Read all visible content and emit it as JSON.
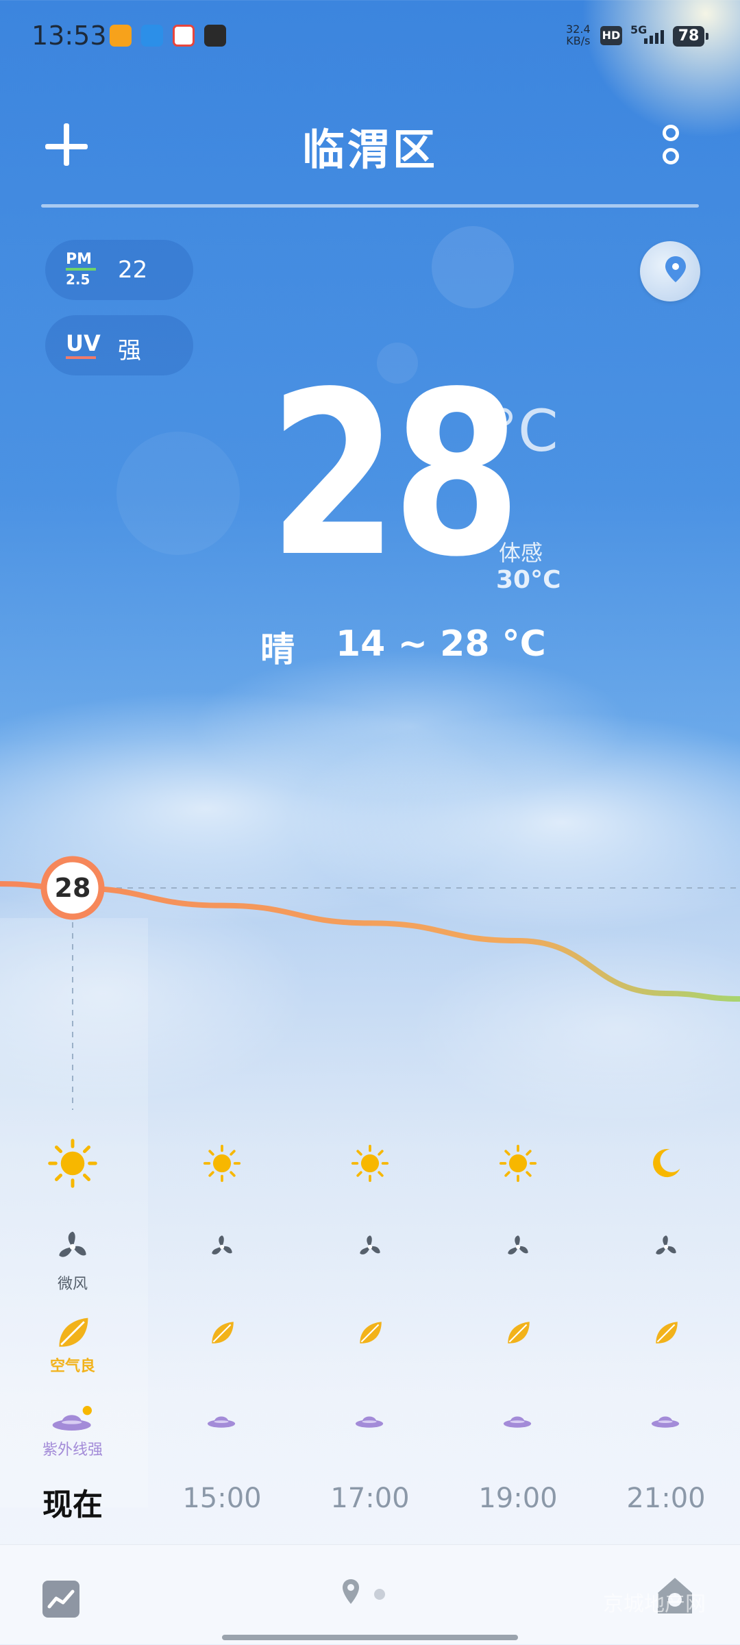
{
  "status_bar": {
    "time": "13:53",
    "app_icons": [
      {
        "name": "weibo-icon",
        "color": "#f7a21b"
      },
      {
        "name": "traffic-app-icon",
        "color": "#2c8fe8"
      },
      {
        "name": "map-app-icon",
        "color": "#e8453c"
      },
      {
        "name": "soul-app-icon",
        "color": "#2a2a2a"
      }
    ],
    "net_rate": "32.4",
    "net_unit": "KB/s",
    "hd": "HD",
    "signal": "5G",
    "battery": "78"
  },
  "header": {
    "city": "临渭区"
  },
  "air": {
    "pm_top": "PM",
    "pm_bottom": "2.5",
    "pm_value": "22",
    "uv_label": "UV",
    "uv_value": "强"
  },
  "current": {
    "temp": "28",
    "unit": "°C",
    "feels_label": "体感",
    "feels_value": "30°C",
    "condition": "晴",
    "range": "14 ~ 28 °C"
  },
  "chart_data": {
    "type": "line",
    "x": [
      "现在",
      "15:00",
      "17:00",
      "19:00",
      "21:00"
    ],
    "series": [
      {
        "values": [
          28,
          27,
          26,
          25,
          22
        ]
      }
    ],
    "current_label": "28"
  },
  "forecast": [
    {
      "time": "现在",
      "icon": "sun-icon",
      "wind_label": "微风",
      "air_label": "空气良",
      "uv_label": "紫外线强",
      "is_now": true
    },
    {
      "time": "15:00",
      "icon": "sun-icon",
      "is_now": false
    },
    {
      "time": "17:00",
      "icon": "sun-icon",
      "is_now": false
    },
    {
      "time": "19:00",
      "icon": "sun-icon",
      "is_now": false
    },
    {
      "time": "21:00",
      "icon": "moon-icon",
      "is_now": false
    }
  ],
  "colors": {
    "accent_orange": "#f6875a",
    "sun": "#f7b700",
    "leaf": "#f2b21a",
    "uv_purple": "#a38bd8",
    "curve_end_green": "#a8d46f"
  },
  "watermark": "京城地产网"
}
